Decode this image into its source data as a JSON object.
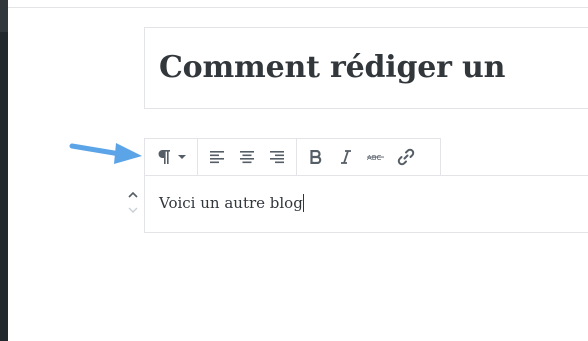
{
  "post": {
    "title": "Comment rédiger un"
  },
  "block": {
    "text": "Voici un autre blog"
  },
  "toolbar": {
    "paragraph_icon": "pilcrow-icon",
    "dropdown_icon": "caret-down-icon",
    "align_left_icon": "align-left-icon",
    "align_center_icon": "align-center-icon",
    "align_right_icon": "align-right-icon",
    "bold_icon": "bold-icon",
    "italic_icon": "italic-icon",
    "strikethrough_icon": "strikethrough-icon",
    "link_icon": "link-icon"
  },
  "colors": {
    "annotation_arrow": "#5ba4e8",
    "sidebar_dark": "#23282d",
    "border": "#e2e4e7",
    "icon": "#555d66",
    "text": "#32373c"
  }
}
